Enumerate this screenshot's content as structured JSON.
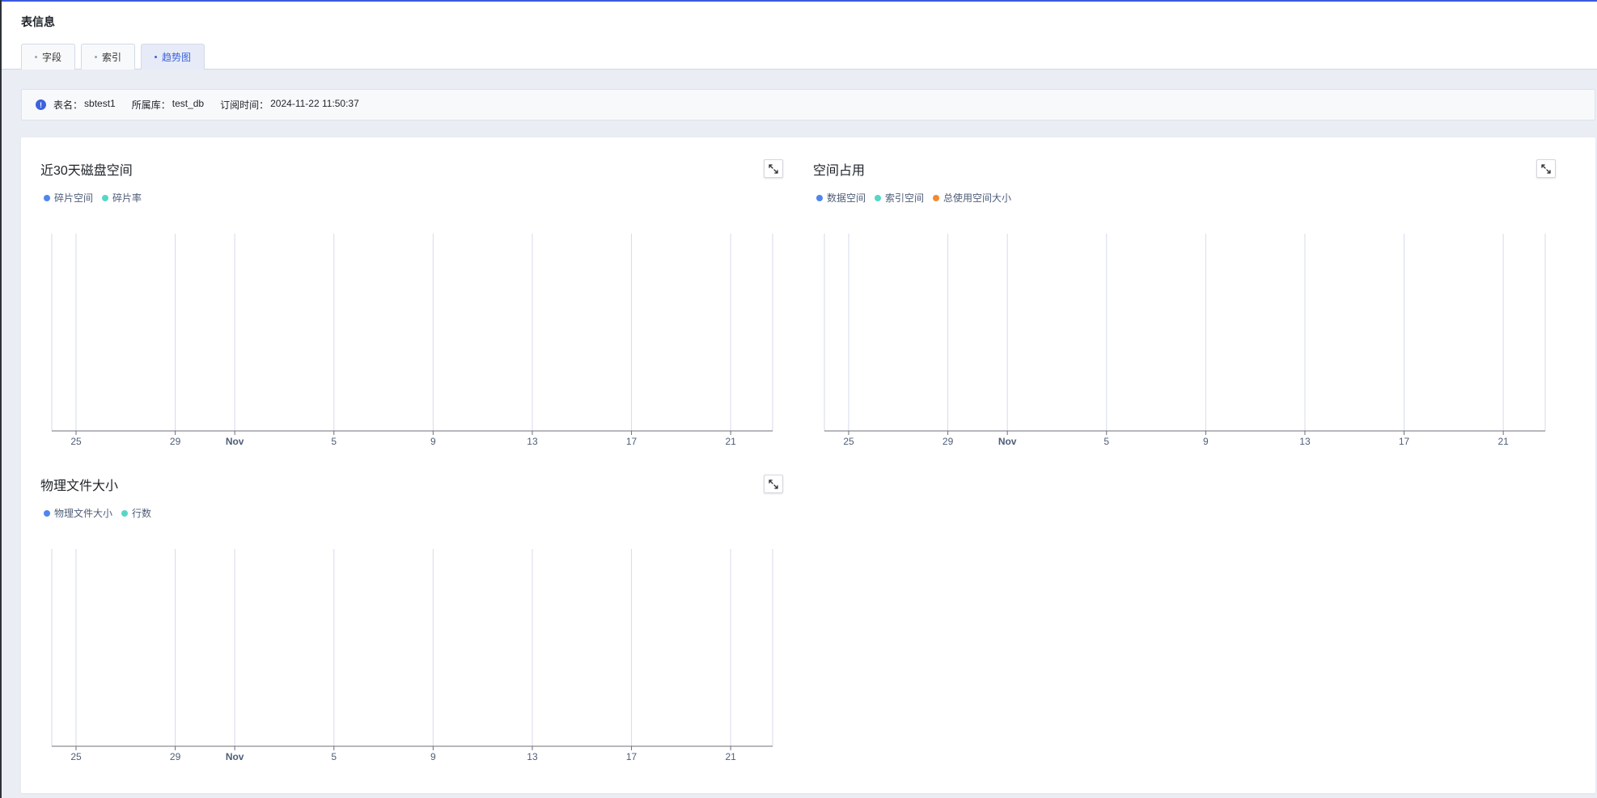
{
  "header": {
    "title": "表信息"
  },
  "tabs": [
    {
      "label": "字段",
      "active": false
    },
    {
      "label": "索引",
      "active": false
    },
    {
      "label": "趋势图",
      "active": true
    }
  ],
  "info": {
    "table_label": "表名：",
    "table_value": "sbtest1",
    "db_label": "所属库：",
    "db_value": "test_db",
    "time_label": "订阅时间：",
    "time_value": "2024-11-22 11:50:37"
  },
  "colors": {
    "accent": "#3d63dd",
    "series_blue": "#4e86f0",
    "series_teal": "#56d7c6",
    "series_orange": "#f28a2e"
  },
  "icons": {
    "expand": "expand-arrows-icon",
    "info": "info-circle-icon"
  },
  "charts": [
    {
      "title": "近30天磁盘空间",
      "legend": [
        {
          "label": "碎片空间",
          "color": "#4e86f0"
        },
        {
          "label": "碎片率",
          "color": "#56d7c6"
        }
      ]
    },
    {
      "title": "空间占用",
      "legend": [
        {
          "label": "数据空间",
          "color": "#4e86f0"
        },
        {
          "label": "索引空间",
          "color": "#56d7c6"
        },
        {
          "label": "总使用空间大小",
          "color": "#f28a2e"
        }
      ]
    },
    {
      "title": "物理文件大小",
      "legend": [
        {
          "label": "物理文件大小",
          "color": "#4e86f0"
        },
        {
          "label": "行数",
          "color": "#56d7c6"
        }
      ]
    }
  ],
  "chart_data": [
    {
      "type": "line",
      "title": "近30天磁盘空间",
      "x_ticks": [
        "25",
        "29",
        "Nov",
        "5",
        "9",
        "13",
        "17",
        "21"
      ],
      "series": [
        {
          "name": "碎片空间",
          "values": []
        },
        {
          "name": "碎片率",
          "values": []
        }
      ],
      "grid": true,
      "legend": "top-left"
    },
    {
      "type": "line",
      "title": "空间占用",
      "x_ticks": [
        "25",
        "29",
        "Nov",
        "5",
        "9",
        "13",
        "17",
        "21"
      ],
      "series": [
        {
          "name": "数据空间",
          "values": []
        },
        {
          "name": "索引空间",
          "values": []
        },
        {
          "name": "总使用空间大小",
          "values": []
        }
      ],
      "grid": true,
      "legend": "top-left"
    },
    {
      "type": "line",
      "title": "物理文件大小",
      "x_ticks": [
        "25",
        "29",
        "Nov",
        "5",
        "9",
        "13",
        "17",
        "21"
      ],
      "series": [
        {
          "name": "物理文件大小",
          "values": []
        },
        {
          "name": "行数",
          "values": []
        }
      ],
      "grid": true,
      "legend": "top-left"
    }
  ]
}
